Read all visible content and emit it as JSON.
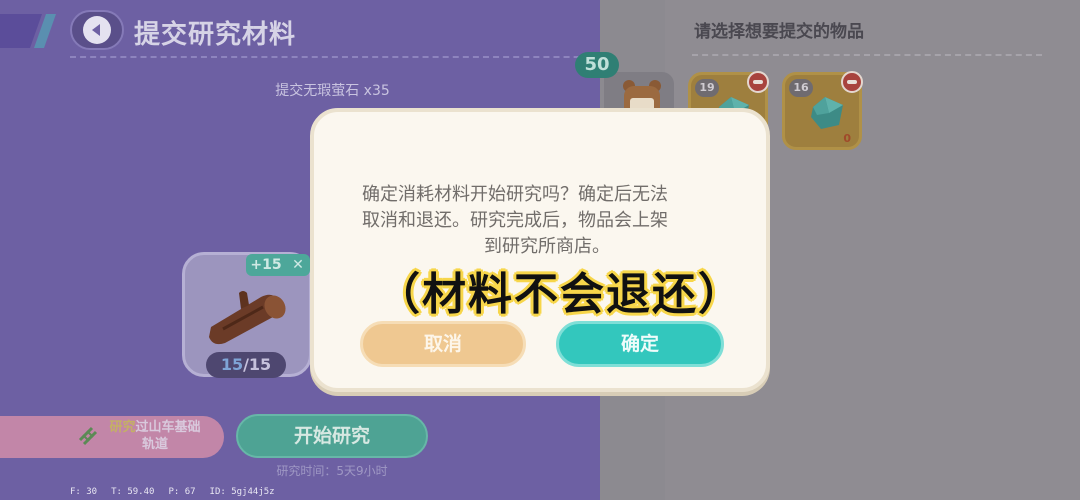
{
  "header": {
    "title": "提交研究材料"
  },
  "submit_info": "提交无瑕萤石 x35",
  "item_card": {
    "plus": "+15",
    "remove": "✕",
    "count_have": "15",
    "count_sep": "/",
    "count_need": "15"
  },
  "research_target": {
    "highlight": "研究",
    "label_rest": "过山车基础",
    "label_line2": "轨道"
  },
  "start_button": "开始研究",
  "research_time": "研究时间：5天9小时",
  "debug": {
    "f": "F: 30",
    "t": "T: 59.40",
    "p": "P: 67",
    "id": "ID: 5gj44j5z"
  },
  "right_panel": {
    "heading": "请选择想要提交的物品",
    "stock": "50",
    "slots": [
      {
        "qty": "19",
        "selected": ""
      },
      {
        "qty": "16",
        "selected": "0"
      }
    ]
  },
  "dialog": {
    "line1": "确定消耗材料开始研究吗？确定后无法",
    "line2": "取消和退还。研究完成后，物品会上架",
    "line3": "到研究所商店。",
    "cancel": "取消",
    "confirm": "确定"
  },
  "caption": "（材料不会退还）",
  "colors": {
    "accent_teal": "#33c7bd",
    "cancel_orange": "#efc891",
    "panel_purple": "#6d60a3",
    "caption_yellow": "#f7d64a"
  },
  "icons": [
    "back-arrow-icon",
    "log-item-icon",
    "bag-icon",
    "gem-icon",
    "minus-icon",
    "track-icon"
  ]
}
